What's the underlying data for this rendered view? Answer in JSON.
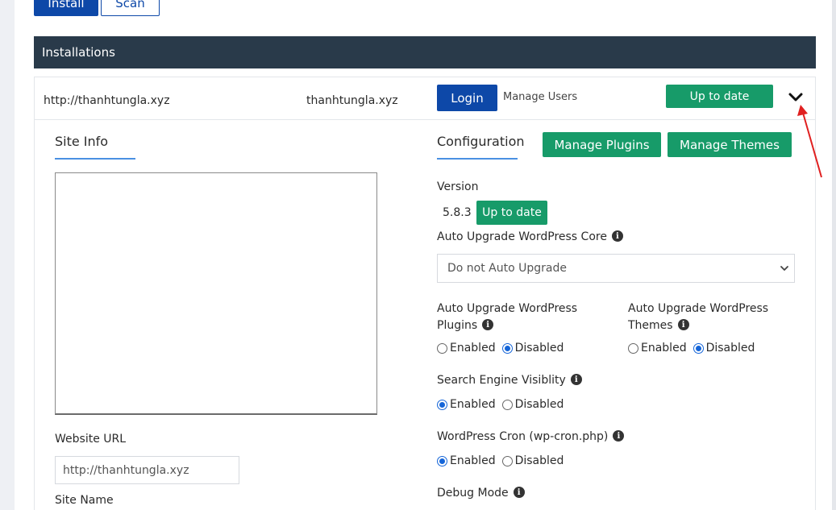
{
  "toolbar": {
    "install_label": "Install",
    "scan_label": "Scan"
  },
  "installations": {
    "header": "Installations",
    "row": {
      "url": "http://thanhtungla.xyz",
      "domain": "thanhtungla.xyz",
      "login_label": "Login",
      "manage_users_label": "Manage Users",
      "status_label": "Up to date"
    }
  },
  "site_info": {
    "title": "Site Info",
    "website_url_label": "Website URL",
    "website_url_value": "http://thanhtungla.xyz",
    "site_name_label": "Site Name"
  },
  "configuration": {
    "title": "Configuration",
    "manage_plugins_label": "Manage Plugins",
    "manage_themes_label": "Manage Themes",
    "version_label": "Version",
    "version_value": "5.8.3",
    "version_status": "Up to date",
    "auto_core_label": "Auto Upgrade WordPress Core",
    "auto_core_selected": "Do not Auto Upgrade",
    "auto_plugins_label": "Auto Upgrade WordPress Plugins",
    "auto_themes_label": "Auto Upgrade WordPress Themes",
    "search_engine_label": "Search Engine Visiblity",
    "cron_label": "WordPress Cron (wp-cron.php)",
    "debug_label": "Debug Mode",
    "enabled_label": "Enabled",
    "disabled_label": "Disabled",
    "auto_plugins_value": "Disabled",
    "auto_themes_value": "Disabled",
    "search_engine_value": "Enabled",
    "cron_value": "Enabled"
  },
  "colors": {
    "primary": "#0d48a8",
    "success": "#179b69",
    "header_bg": "#293a4a",
    "accent_underline": "#4a90e2",
    "annotation_arrow": "#e02020"
  },
  "icons": [
    "chevron-down-icon",
    "info-icon",
    "annotation-arrow"
  ]
}
